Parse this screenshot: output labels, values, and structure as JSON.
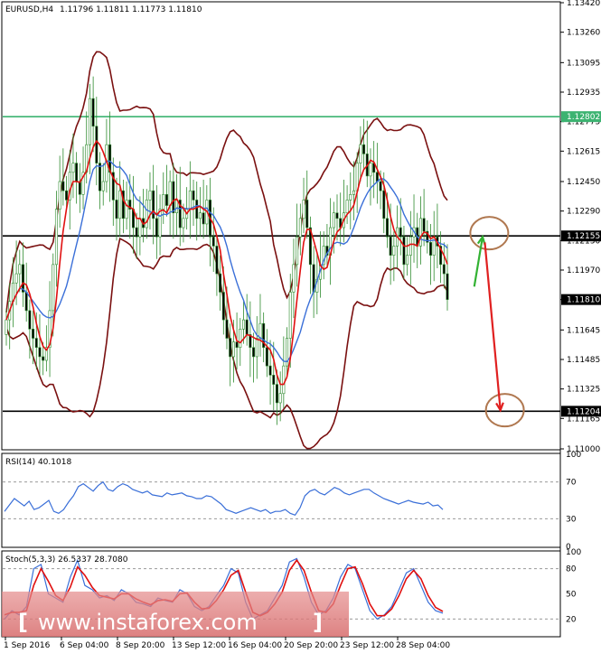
{
  "chart_data": {
    "type": "candlestick",
    "symbol": "EURUSD,H4",
    "ohlc_header": "1.11796 1.11811 1.11773 1.11810",
    "price_axis": {
      "min": 1.11,
      "max": 1.1342,
      "ticks": [
        "1.13420",
        "1.13260",
        "1.13095",
        "1.12935",
        "1.12775",
        "1.12615",
        "1.12450",
        "1.12290",
        "1.12130",
        "1.11970",
        "1.11810",
        "1.11645",
        "1.11485",
        "1.11325",
        "1.11165",
        "1.11000"
      ],
      "markers": [
        {
          "label": "1.12802",
          "value": 1.12802,
          "color": "#3cb371"
        },
        {
          "label": "1.12155",
          "value": 1.12155,
          "color": "#000000"
        },
        {
          "label": "1.11810",
          "value": 1.1181,
          "color": "#000000"
        },
        {
          "label": "1.11204",
          "value": 1.11204,
          "color": "#000000"
        }
      ]
    },
    "horizontal_lines": [
      {
        "value": 1.12802,
        "color": "#3cb371"
      },
      {
        "value": 1.12155,
        "color": "#000000"
      },
      {
        "value": 1.11204,
        "color": "#000000"
      }
    ],
    "x_labels": [
      "1 Sep 2016",
      "6 Sep 04:00",
      "8 Sep 20:00",
      "13 Sep 12:00",
      "16 Sep 04:00",
      "20 Sep 20:00",
      "23 Sep 12:00",
      "28 Sep 04:00"
    ],
    "close_path": [
      1.117,
      1.118,
      1.119,
      1.1195,
      1.12,
      1.1185,
      1.1175,
      1.1165,
      1.116,
      1.1155,
      1.115,
      1.1148,
      1.1155,
      1.1175,
      1.12,
      1.123,
      1.1245,
      1.124,
      1.1235,
      1.125,
      1.1255,
      1.1245,
      1.1238,
      1.125,
      1.1265,
      1.129,
      1.1275,
      1.1255,
      1.124,
      1.1245,
      1.1265,
      1.125,
      1.1235,
      1.1225,
      1.124,
      1.1225,
      1.1235,
      1.123,
      1.122,
      1.1215,
      1.1225,
      1.122,
      1.1235,
      1.124,
      1.1225,
      1.1215,
      1.123,
      1.1238,
      1.1232,
      1.1245,
      1.1228,
      1.1235,
      1.122,
      1.1225,
      1.123,
      1.124,
      1.1235,
      1.1225,
      1.1228,
      1.1222,
      1.1235,
      1.1215,
      1.121,
      1.1195,
      1.1185,
      1.117,
      1.116,
      1.115,
      1.1158,
      1.1155,
      1.1165,
      1.117,
      1.1162,
      1.1155,
      1.115,
      1.116,
      1.1168,
      1.1155,
      1.1145,
      1.114,
      1.1135,
      1.1125,
      1.113,
      1.1145,
      1.116,
      1.1185,
      1.12,
      1.1215,
      1.1225,
      1.1235,
      1.122,
      1.12,
      1.1185,
      1.1192,
      1.12,
      1.121,
      1.1205,
      1.122,
      1.1228,
      1.1225,
      1.122,
      1.1228,
      1.1235,
      1.1238,
      1.124,
      1.1255,
      1.1265,
      1.126,
      1.1248,
      1.1255,
      1.125,
      1.1245,
      1.124,
      1.1225,
      1.1215,
      1.1205,
      1.121,
      1.122,
      1.1215,
      1.12,
      1.1205,
      1.1215,
      1.122,
      1.121,
      1.1225,
      1.1218,
      1.1212,
      1.1205,
      1.1215,
      1.121,
      1.12,
      1.1195,
      1.1181
    ],
    "arrows": [
      {
        "color": "#33b233",
        "from": [
          1.1188,
          0.847
        ],
        "to": [
          1.1215,
          0.862
        ]
      },
      {
        "color": "#e02020",
        "from": [
          1.1212,
          0.866
        ],
        "to": [
          1.1121,
          0.894
        ]
      }
    ],
    "ellipses": [
      {
        "color": "#b07850",
        "center_price": 1.1217,
        "center_t": 0.874
      },
      {
        "color": "#b07850",
        "center_price": 1.1121,
        "center_t": 0.902
      }
    ],
    "rsi": {
      "label": "RSI(14) 40.1018",
      "ticks": [
        "100",
        "70",
        "30",
        "0"
      ],
      "values": [
        38,
        45,
        52,
        48,
        44,
        49,
        40,
        42,
        46,
        50,
        38,
        36,
        40,
        48,
        55,
        65,
        68,
        64,
        60,
        66,
        70,
        62,
        60,
        65,
        68,
        66,
        62,
        60,
        58,
        60,
        56,
        55,
        54,
        58,
        56,
        57,
        58,
        55,
        54,
        52,
        52,
        55,
        54,
        50,
        46,
        40,
        38,
        36,
        38,
        40,
        42,
        40,
        38,
        40,
        36,
        38,
        38,
        40,
        36,
        34,
        42,
        55,
        60,
        62,
        58,
        56,
        60,
        64,
        62,
        58,
        56,
        58,
        60,
        62,
        62,
        58,
        55,
        52,
        50,
        48,
        46,
        48,
        50,
        48,
        47,
        46,
        48,
        44,
        45,
        40
      ]
    },
    "stoch": {
      "label": "Stoch(5,3,3) 26.5337 28.7080",
      "ticks": [
        "100",
        "80",
        "50",
        "20"
      ],
      "main": [
        20,
        30,
        25,
        35,
        80,
        85,
        50,
        45,
        40,
        70,
        90,
        60,
        55,
        45,
        48,
        42,
        55,
        50,
        40,
        38,
        35,
        45,
        42,
        40,
        55,
        50,
        35,
        30,
        35,
        48,
        60,
        80,
        75,
        40,
        20,
        25,
        30,
        45,
        60,
        88,
        92,
        70,
        40,
        25,
        30,
        45,
        70,
        85,
        80,
        55,
        30,
        20,
        25,
        35,
        55,
        75,
        80,
        60,
        40,
        30,
        27
      ],
      "signal": [
        25,
        28,
        28,
        30,
        60,
        80,
        65,
        48,
        42,
        58,
        82,
        72,
        58,
        48,
        46,
        44,
        50,
        50,
        44,
        40,
        37,
        42,
        43,
        41,
        50,
        51,
        40,
        32,
        33,
        42,
        55,
        72,
        78,
        52,
        28,
        24,
        28,
        38,
        52,
        78,
        90,
        78,
        52,
        30,
        28,
        38,
        60,
        80,
        82,
        62,
        38,
        24,
        24,
        32,
        48,
        68,
        78,
        68,
        48,
        34,
        29
      ]
    },
    "watermark": "www.instaforex.com"
  }
}
